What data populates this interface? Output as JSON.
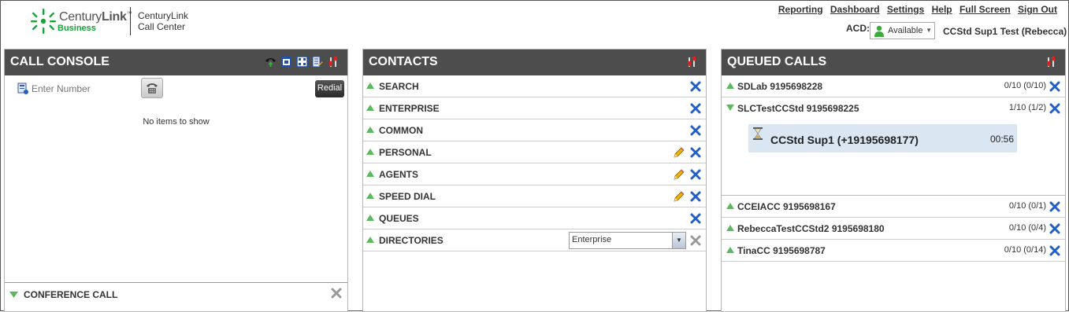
{
  "header": {
    "brand_name_prefix": "Century",
    "brand_name_bold": "Link",
    "brand_tm": "™",
    "brand_sub": "Business",
    "product_line1": "CenturyLink",
    "product_line2": "Call Center",
    "nav": [
      "Reporting",
      "Dashboard",
      "Settings",
      "Help",
      "Full Screen",
      "Sign Out"
    ],
    "acd_label": "ACD:",
    "acd_status": "Available",
    "user": "CCStd Sup1 Test (Rebecca)"
  },
  "colors": {
    "panel_header": "#4d4d4d",
    "brand_green": "#1aa33c",
    "close_blue": "#1f5fc6",
    "call_card": "#dbe6f3"
  },
  "call_console": {
    "title": "CALL CONSOLE",
    "header_icons": [
      "transfer-phone-icon",
      "calendar-icon",
      "grid-icon",
      "edit-list-icon",
      "settings-tools-icon"
    ],
    "enter_number_placeholder": "Enter Number",
    "redial_label": "Redial",
    "empty_text": "No items to show",
    "conference": {
      "label": "CONFERENCE CALL"
    }
  },
  "contacts": {
    "title": "CONTACTS",
    "rows": [
      {
        "label": "SEARCH",
        "editable": false
      },
      {
        "label": "ENTERPRISE",
        "editable": false
      },
      {
        "label": "COMMON",
        "editable": false
      },
      {
        "label": "PERSONAL",
        "editable": true
      },
      {
        "label": "AGENTS",
        "editable": true
      },
      {
        "label": "SPEED DIAL",
        "editable": true
      },
      {
        "label": "QUEUES",
        "editable": false
      }
    ],
    "directories": {
      "label": "DIRECTORIES",
      "selected": "Enterprise"
    }
  },
  "queued_calls": {
    "title": "QUEUED CALLS",
    "top_queues": [
      {
        "label": "SDLab 9195698228",
        "count": "0/10 (0/10)",
        "expanded": false
      },
      {
        "label": "SLCTestCCStd 9195698225",
        "count": "1/10 (1/2)",
        "expanded": true
      }
    ],
    "active_call": {
      "caller": "CCStd Sup1 (+19195698177)",
      "duration": "00:56"
    },
    "other_queues": [
      {
        "label": "CCEIACC 9195698167",
        "count": "0/10 (0/1)"
      },
      {
        "label": "RebeccaTestCCStd2 9195698180",
        "count": "0/10 (0/4)"
      },
      {
        "label": "TinaCC 9195698787",
        "count": "0/10 (0/14)"
      }
    ]
  }
}
